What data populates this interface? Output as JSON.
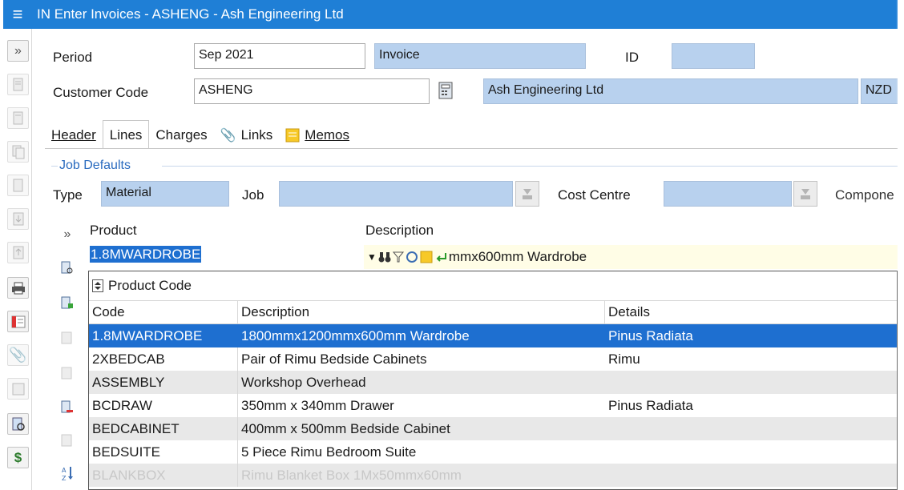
{
  "window": {
    "title": "IN Enter Invoices - ASHENG - Ash Engineering Ltd",
    "menu_glyph": "≡"
  },
  "header": {
    "period_label": "Period",
    "period_value": "Sep 2021",
    "type_value": "Invoice",
    "id_label": "ID",
    "id_value": "",
    "customer_label": "Customer Code",
    "customer_value": "ASHENG",
    "customer_name": "Ash Engineering Ltd",
    "currency": "NZD"
  },
  "tabs": [
    {
      "label": "Header",
      "active": false
    },
    {
      "label": "Lines",
      "active": true
    },
    {
      "label": "Charges",
      "active": false
    },
    {
      "label": "Links",
      "active": false
    },
    {
      "label": "Memos",
      "active": false
    }
  ],
  "job_defaults": {
    "title": "Job Defaults",
    "type_label": "Type",
    "type_value": "Material",
    "job_label": "Job",
    "job_value": "",
    "cost_centre_label": "Cost Centre",
    "cost_centre_value": "",
    "component_label": "Compone"
  },
  "lines": {
    "expand_glyph": "»",
    "product_label": "Product",
    "description_label": "Description",
    "product_value": "1.8MWARDROBE",
    "description_value": "mmx600mm Wardrobe"
  },
  "dropdown": {
    "sort_label": "Product Code",
    "columns": [
      "Code",
      "Description",
      "Details"
    ],
    "rows": [
      {
        "code": "1.8MWARDROBE",
        "description": "1800mmx1200mmx600mm Wardrobe",
        "details": "Pinus Radiata"
      },
      {
        "code": "2XBEDCAB",
        "description": "Pair of Rimu Bedside Cabinets",
        "details": "Rimu"
      },
      {
        "code": "ASSEMBLY",
        "description": "Workshop Overhead",
        "details": ""
      },
      {
        "code": "BCDRAW",
        "description": "350mm x 340mm Drawer",
        "details": "Pinus Radiata"
      },
      {
        "code": "BEDCABINET",
        "description": "400mm x 500mm Bedside Cabinet",
        "details": ""
      },
      {
        "code": "BEDSUITE",
        "description": "5 Piece Rimu Bedroom Suite",
        "details": ""
      },
      {
        "code": "BLANKBOX",
        "description": "Rimu Blanket Box 1Mx50mmx60mm",
        "details": ""
      }
    ]
  },
  "colors": {
    "titlebar": "#1f7fd6",
    "readonly_field": "#b8d1ee",
    "selection": "#1e6fd0",
    "accent_text": "#2a6bbf"
  },
  "icons": [
    "menu-icon",
    "expand-icon",
    "calculator-icon",
    "attachment-icon",
    "memo-icon",
    "dropdown-download-icon",
    "binoculars-icon",
    "filter-icon",
    "sort-icon",
    "print-icon"
  ]
}
